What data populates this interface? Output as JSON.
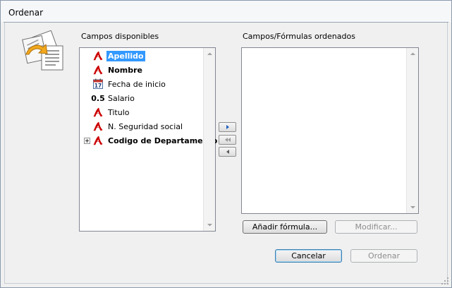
{
  "window": {
    "title": "Ordenar"
  },
  "available": {
    "label": "Campos disponibles",
    "items": [
      {
        "label": "Apellido",
        "icon": "text-field-icon",
        "bold": true,
        "selected": true,
        "expandable": false
      },
      {
        "label": "Nombre",
        "icon": "text-field-icon",
        "bold": true,
        "selected": false,
        "expandable": false
      },
      {
        "label": "Fecha de inicio",
        "icon": "calendar-field-icon",
        "bold": false,
        "selected": false,
        "expandable": false
      },
      {
        "label": "Salario",
        "icon": "number-field-icon",
        "icon_text": "0.5",
        "bold": false,
        "selected": false,
        "expandable": false
      },
      {
        "label": "Titulo",
        "icon": "text-field-icon",
        "bold": false,
        "selected": false,
        "expandable": false
      },
      {
        "label": "N. Seguridad social",
        "icon": "text-field-icon",
        "bold": false,
        "selected": false,
        "expandable": false
      },
      {
        "label": "Codigo de Departamento",
        "icon": "text-field-icon",
        "bold": true,
        "selected": false,
        "expandable": true
      }
    ]
  },
  "sorted": {
    "label": "Campos/Fórmulas ordenados",
    "items": []
  },
  "buttons": {
    "add_formula": "Añadir fórmula...",
    "modify": "Modificar...",
    "cancel": "Cancelar",
    "sort": "Ordenar"
  },
  "colors": {
    "selection": "#3399ff",
    "text_field_icon": "#cc0000"
  }
}
